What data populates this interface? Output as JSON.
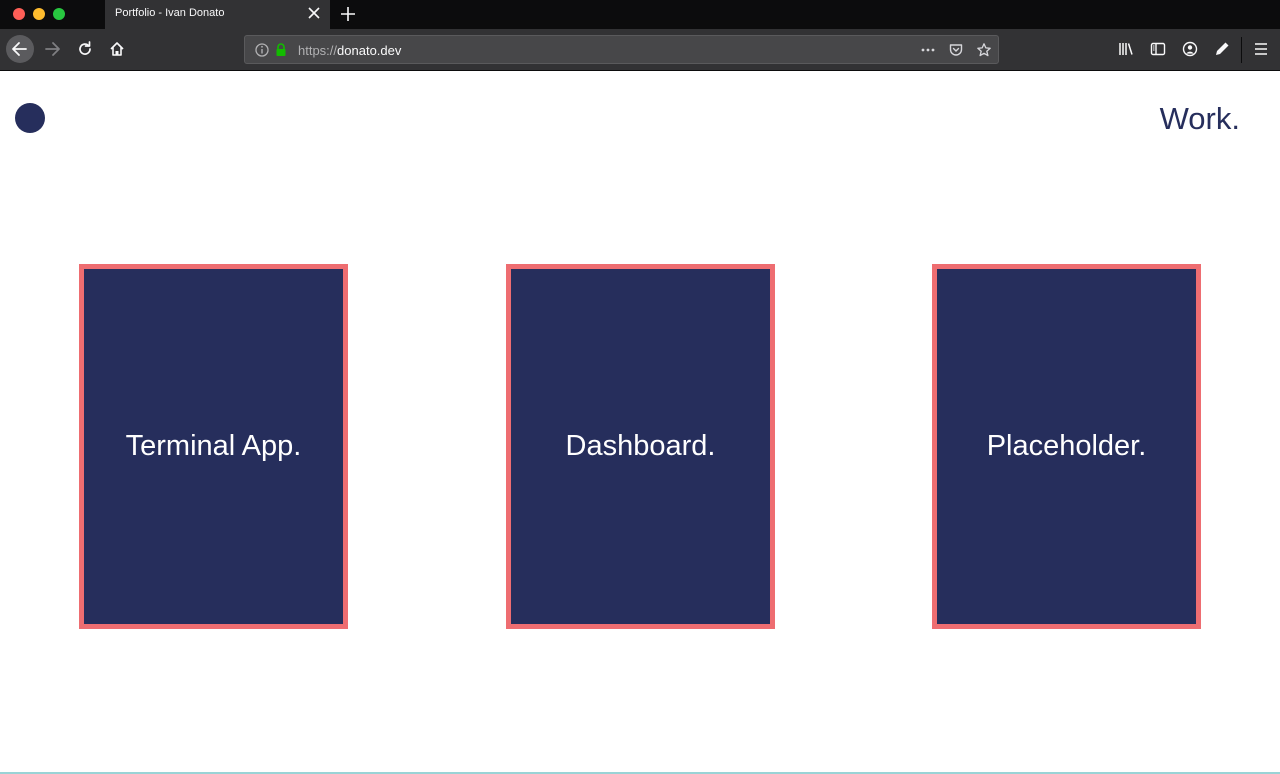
{
  "browser": {
    "tab_title": "Portfolio - Ivan Donato",
    "url_scheme": "https://",
    "url_host": "donato.dev"
  },
  "page": {
    "nav": {
      "work_label": "Work."
    },
    "projects": [
      {
        "title": "Terminal App."
      },
      {
        "title": "Dashboard."
      },
      {
        "title": "Placeholder."
      }
    ]
  },
  "colors": {
    "brand_navy": "#262e5c",
    "card_border": "#ee6d71",
    "chrome_dark": "#0c0c0d",
    "chrome_toolbar": "#323234"
  }
}
